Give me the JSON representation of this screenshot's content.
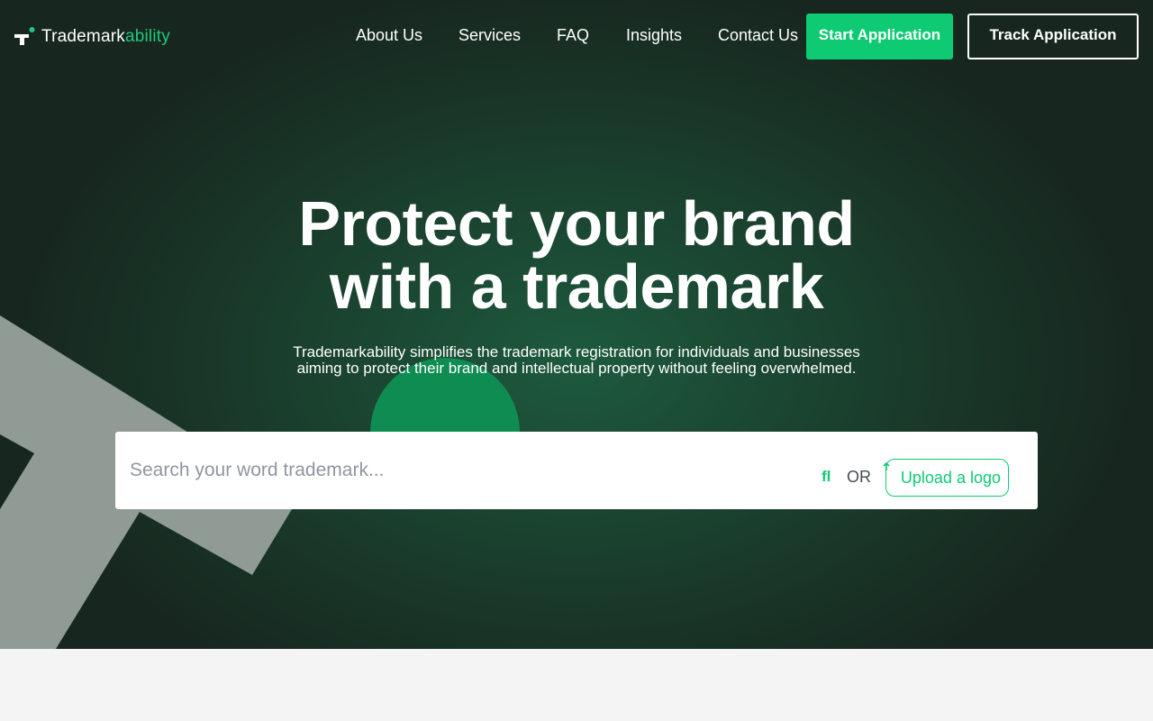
{
  "brand": {
    "name_main": "Trademark",
    "name_accent": "ability",
    "accent_color": "#0ecb73"
  },
  "nav": {
    "links": [
      "About Us",
      "Services",
      "FAQ",
      "Insights",
      "Contact Us"
    ],
    "start_application": "Start Application",
    "track_application": "Track Application"
  },
  "hero": {
    "headline_line1": "Protect your brand",
    "headline_line2": "with a trademark",
    "subtext_line1": "Trademarkability simplifies the trademark registration for individuals and businesses",
    "subtext_line2": "aiming to protect their brand and intellectual property without feeling overwhelmed."
  },
  "search": {
    "placeholder": "Search your word trademark...",
    "search_icon_glyph": "fl",
    "or_label": "OR",
    "upload_label": "Upload a logo"
  },
  "icons": {
    "logo": "trademark-t-icon",
    "search": "search-icon",
    "upload": "upload-arrow-icon"
  }
}
